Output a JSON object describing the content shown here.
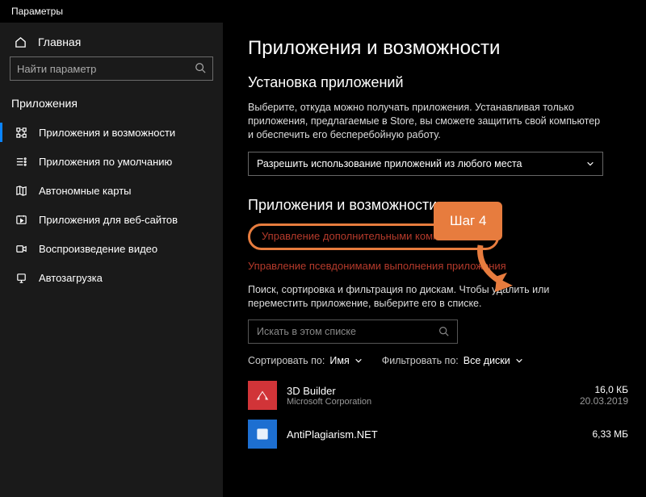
{
  "window_title": "Параметры",
  "sidebar": {
    "home": "Главная",
    "search_placeholder": "Найти параметр",
    "section": "Приложения",
    "items": [
      {
        "label": "Приложения и возможности",
        "icon": "apps-icon",
        "active": true
      },
      {
        "label": "Приложения по умолчанию",
        "icon": "defaults-icon",
        "active": false
      },
      {
        "label": "Автономные карты",
        "icon": "maps-icon",
        "active": false
      },
      {
        "label": "Приложения для веб-сайтов",
        "icon": "websites-icon",
        "active": false
      },
      {
        "label": "Воспроизведение видео",
        "icon": "video-icon",
        "active": false
      },
      {
        "label": "Автозагрузка",
        "icon": "startup-icon",
        "active": false
      }
    ]
  },
  "content": {
    "title": "Приложения и возможности",
    "install_heading": "Установка приложений",
    "install_desc": "Выберите, откуда можно получать приложения. Устанавливая только приложения, предлагаемые в Store, вы сможете защитить свой компьютер и обеспечить его бесперебойную работу.",
    "dropdown_value": "Разрешить использование приложений из любого места",
    "sub_heading": "Приложения и возможности",
    "link1": "Управление дополнительными компонентами",
    "link2": "Управление псевдонимами выполнения приложения",
    "search_desc": "Поиск, сортировка и фильтрация по дискам. Чтобы удалить или переместить приложение, выберите его в списке.",
    "list_search_placeholder": "Искать в этом списке",
    "sort_label": "Сортировать по:",
    "sort_value": "Имя",
    "filter_label": "Фильтровать по:",
    "filter_value": "Все диски",
    "apps": [
      {
        "name": "3D Builder",
        "publisher": "Microsoft Corporation",
        "size": "16,0 КБ",
        "date": "20.03.2019",
        "icon_color": "bg-red"
      },
      {
        "name": "AntiPlagiarism.NET",
        "publisher": "",
        "size": "6,33 МБ",
        "date": "",
        "icon_color": "bg-blue"
      }
    ]
  },
  "annotation": {
    "step_label": "Шаг 4"
  }
}
